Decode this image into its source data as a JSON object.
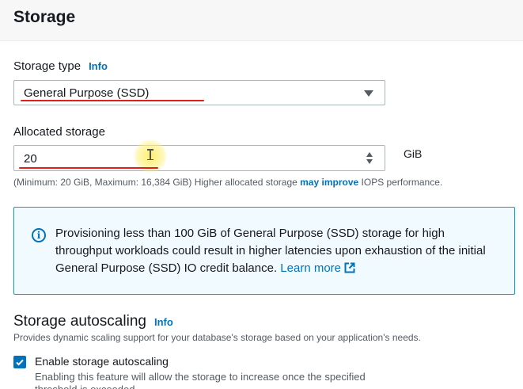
{
  "section": {
    "title": "Storage"
  },
  "storage_type": {
    "label": "Storage type",
    "info": "Info",
    "selected": "General Purpose (SSD)"
  },
  "allocated_storage": {
    "label": "Allocated storage",
    "value": "20",
    "unit": "GiB",
    "hint_prefix": "(Minimum: 20 GiB, Maximum: 16,384 GiB) Higher allocated storage ",
    "hint_link": "may improve",
    "hint_suffix": " IOPS performance."
  },
  "alert": {
    "icon": "info-circle-icon",
    "text": "Provisioning less than 100 GiB of General Purpose (SSD) storage for high throughput workloads could result in higher latencies upon exhaustion of the initial General Purpose (SSD) IO credit balance. ",
    "link": "Learn more",
    "accent": "#0073bb",
    "background": "#f1faff"
  },
  "autoscaling": {
    "title": "Storage autoscaling",
    "info": "Info",
    "description": "Provides dynamic scaling support for your database's storage based on your application's needs.",
    "checkbox_checked": true,
    "checkbox_label": "Enable storage autoscaling",
    "checkbox_description": "Enabling this feature will allow the storage to increase once the specified threshold is exceeded."
  },
  "annotations": {
    "underline_color": "#e0201b",
    "cursor_highlight": "#ffee64"
  }
}
